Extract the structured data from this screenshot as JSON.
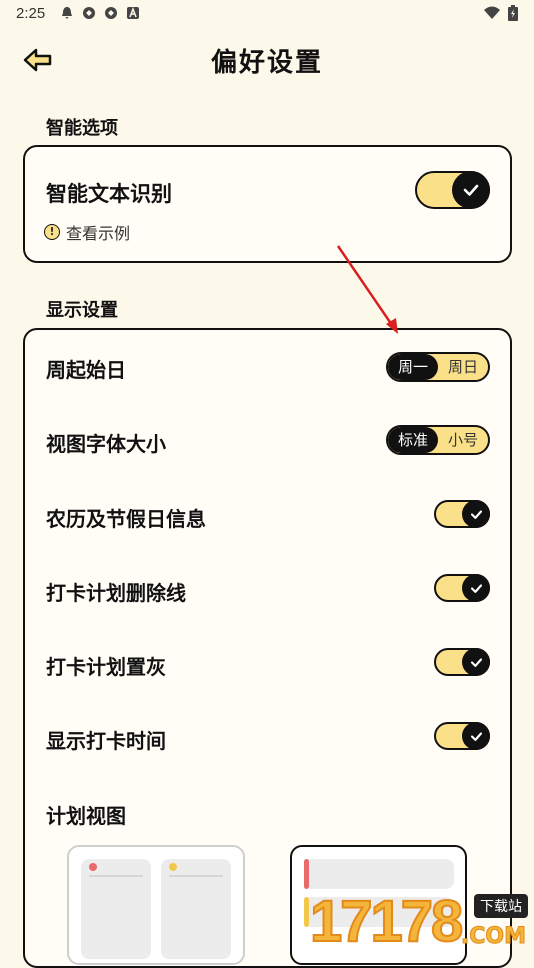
{
  "status_bar": {
    "time": "2:25"
  },
  "header": {
    "title": "偏好设置"
  },
  "smart": {
    "section_title": "智能选项",
    "text_recognition_label": "智能文本识别",
    "view_example_label": "查看示例"
  },
  "display": {
    "section_title": "显示设置",
    "week_start": {
      "label": "周起始日",
      "options": [
        "周一",
        "周日"
      ],
      "selected": "周一"
    },
    "font_size": {
      "label": "视图字体大小",
      "options": [
        "标准",
        "小号"
      ],
      "selected": "标准"
    },
    "lunar_holiday": {
      "label": "农历及节假日信息"
    },
    "checkin_strike": {
      "label": "打卡计划删除线"
    },
    "checkin_gray": {
      "label": "打卡计划置灰"
    },
    "show_checkin_time": {
      "label": "显示打卡时间"
    },
    "plan_view_label": "计划视图"
  },
  "watermark": {
    "digits": "17178",
    "badge": "下载站",
    "suffix": ".COM"
  },
  "colors": {
    "accent": "#fbe08a",
    "background": "#fdf9ea",
    "annotation_arrow": "#d91e1e"
  }
}
